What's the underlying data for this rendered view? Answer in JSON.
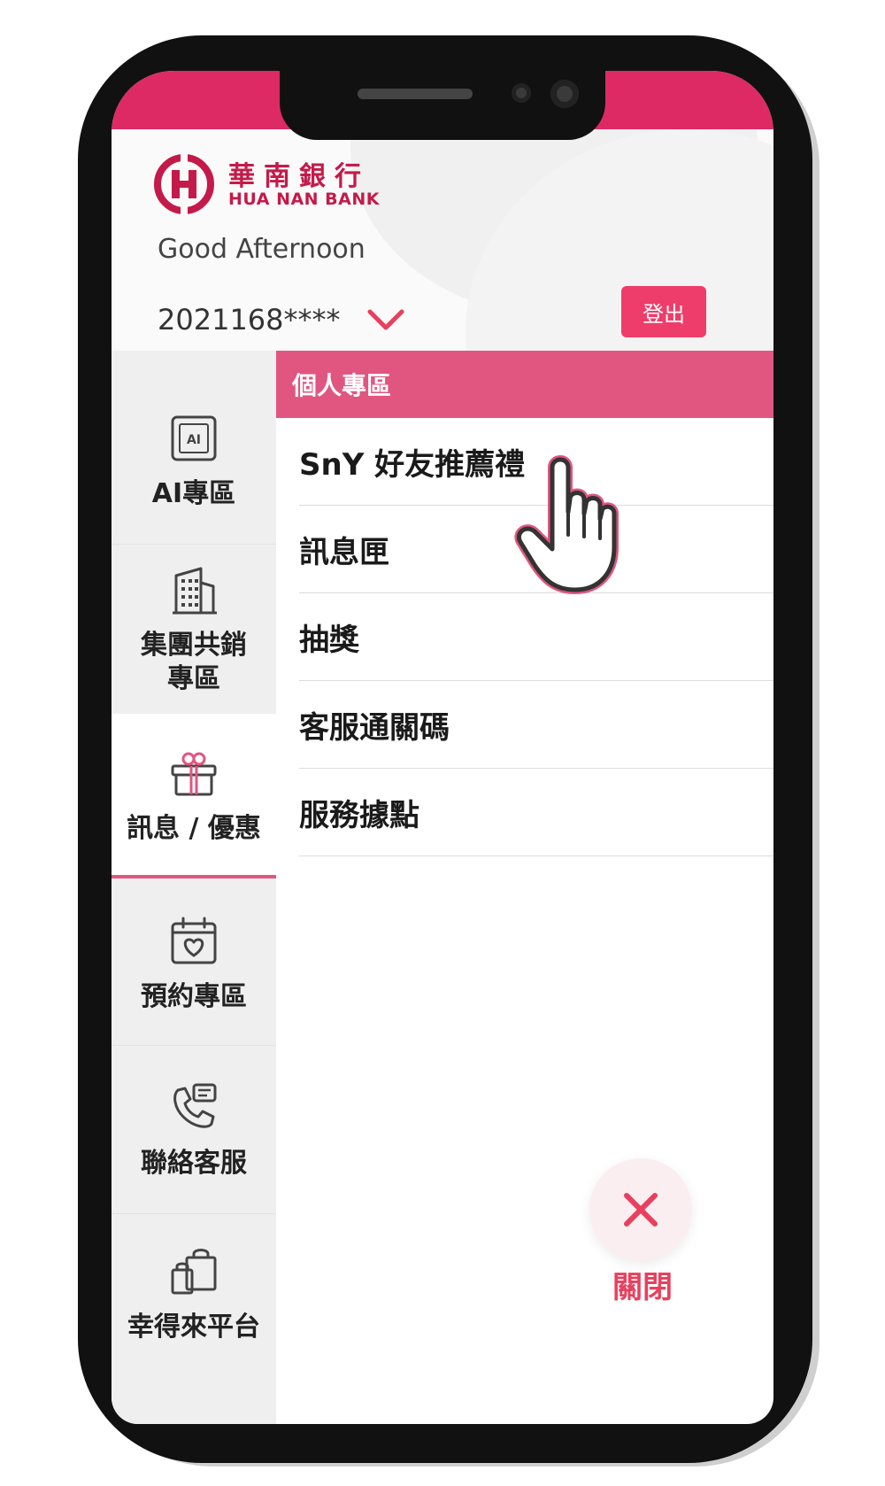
{
  "bank": {
    "name_cn": "華南銀行",
    "name_en": "HUA NAN BANK"
  },
  "header": {
    "greeting": "Good Afternoon",
    "account": "2021168****",
    "logout_label": "登出"
  },
  "sidebar": {
    "items": [
      {
        "label": "AI專區",
        "icon": "ai-icon",
        "active": false
      },
      {
        "label": "集團共銷\n專區",
        "icon": "building-icon",
        "active": false
      },
      {
        "label": "訊息 / 優惠",
        "icon": "gift-icon",
        "active": true
      },
      {
        "label": "預約專區",
        "icon": "calendar-heart-icon",
        "active": false
      },
      {
        "label": "聯絡客服",
        "icon": "phone-chat-icon",
        "active": false
      },
      {
        "label": "幸得來平台",
        "icon": "shopping-bags-icon",
        "active": false
      }
    ]
  },
  "panel": {
    "title": "個人專區",
    "items": [
      {
        "label": "SnY 好友推薦禮"
      },
      {
        "label": "訊息匣"
      },
      {
        "label": "抽獎"
      },
      {
        "label": "客服通關碼"
      },
      {
        "label": "服務據點"
      }
    ]
  },
  "close": {
    "label": "關閉"
  },
  "colors": {
    "brand": "#dd2a64",
    "accent": "#e05680",
    "logout": "#ee3d6a",
    "close": "#e8405e"
  }
}
